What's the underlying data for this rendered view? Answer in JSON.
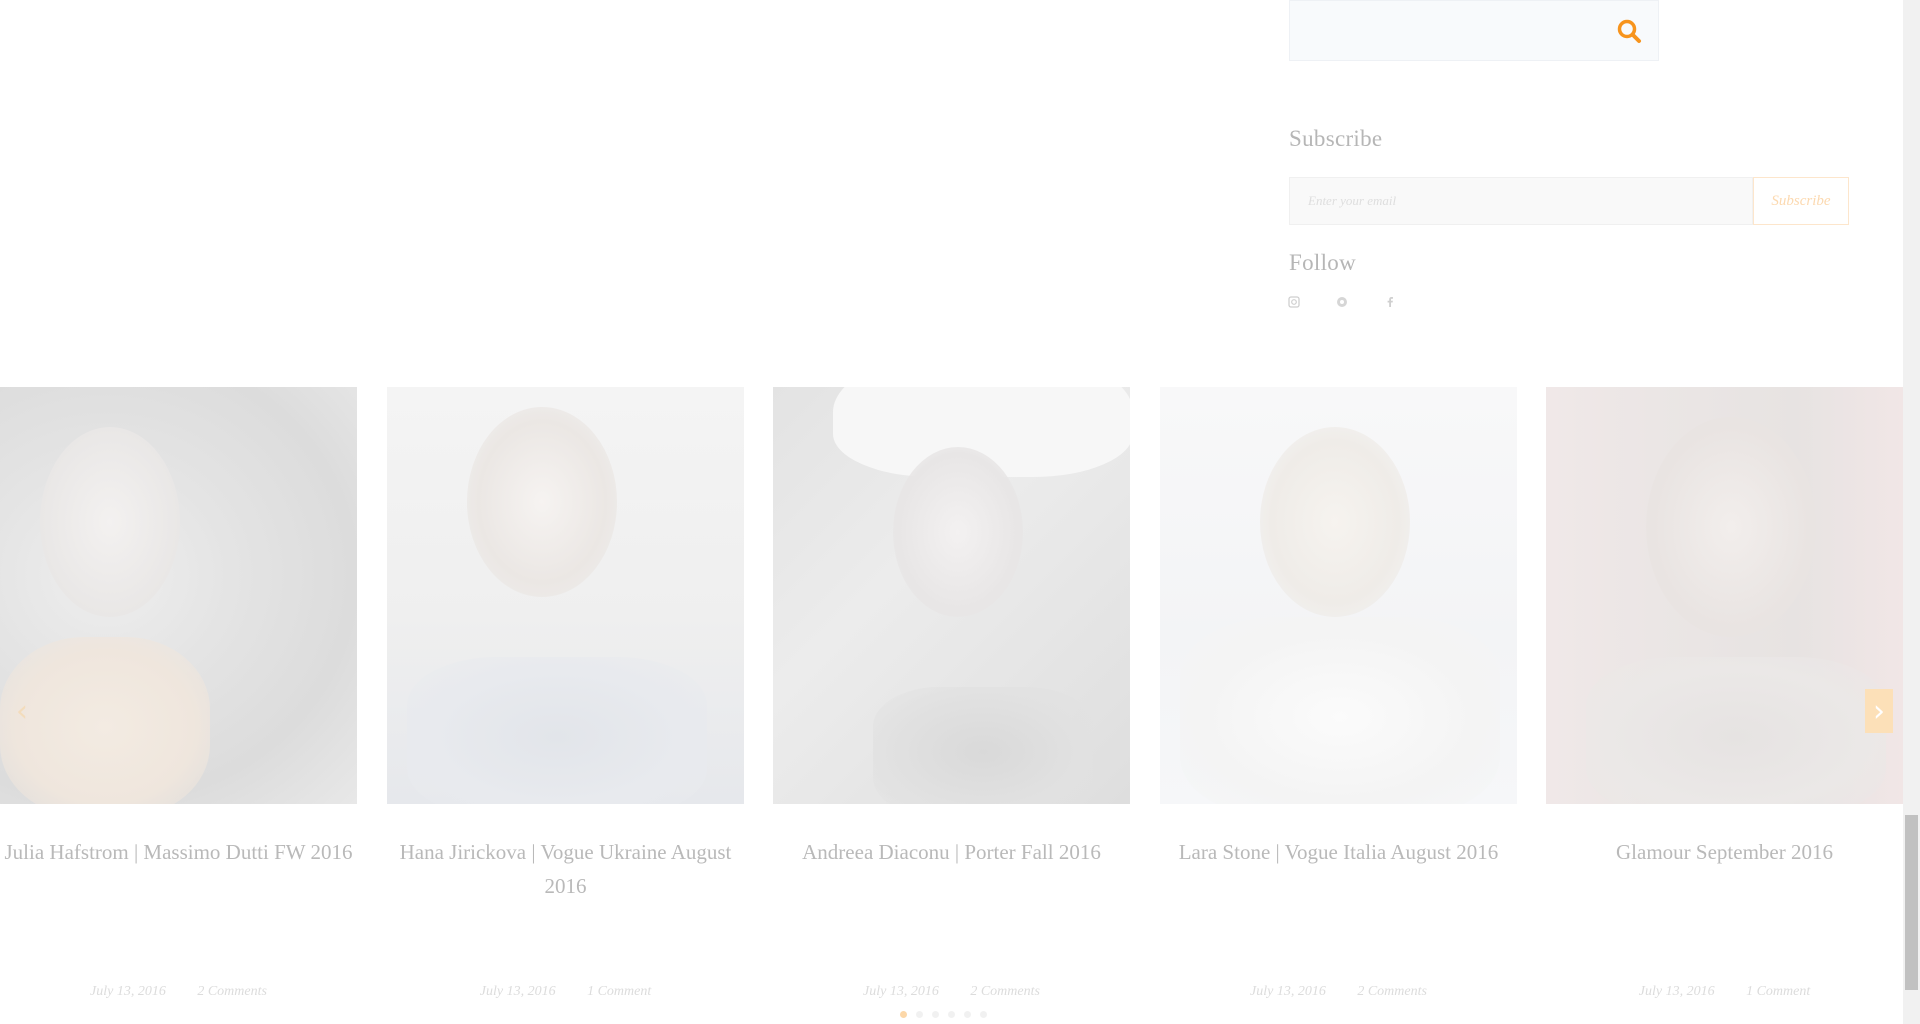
{
  "search": {
    "placeholder": ""
  },
  "subscribe": {
    "title": "Subscribe",
    "email_placeholder": "Enter your email",
    "button_label": "Subscribe"
  },
  "follow": {
    "title": "Follow",
    "icons": [
      "instagram-icon",
      "pinterest-icon",
      "facebook-icon"
    ]
  },
  "colors": {
    "accent": "#f7941d",
    "accent_faded": "#fcd9b0"
  },
  "posts": [
    {
      "title": "Julia Hafstrom | Massimo Dutti FW 2016",
      "date": "July 13, 2016",
      "comments": "2 Comments"
    },
    {
      "title": "Hana Jirickova | Vogue Ukraine August 2016",
      "date": "July 13, 2016",
      "comments": "1 Comment"
    },
    {
      "title": "Andreea Diaconu | Porter Fall 2016",
      "date": "July 13, 2016",
      "comments": "2 Comments"
    },
    {
      "title": "Lara Stone | Vogue Italia August 2016",
      "date": "July 13, 2016",
      "comments": "2 Comments"
    },
    {
      "title": "Glamour September 2016",
      "date": "July 13, 2016",
      "comments": "1 Comment"
    }
  ],
  "carousel": {
    "dot_count": 6,
    "active_dot": 1
  }
}
